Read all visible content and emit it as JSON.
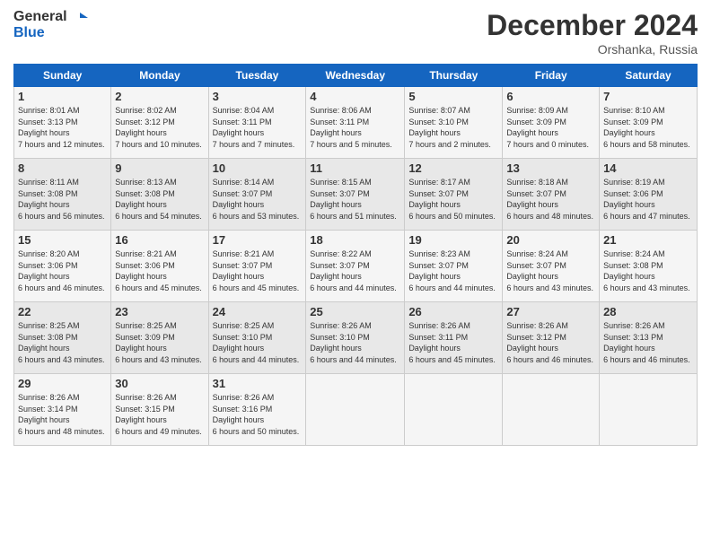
{
  "header": {
    "logo_line1": "General",
    "logo_line2": "Blue",
    "month": "December 2024",
    "location": "Orshanka, Russia"
  },
  "weekdays": [
    "Sunday",
    "Monday",
    "Tuesday",
    "Wednesday",
    "Thursday",
    "Friday",
    "Saturday"
  ],
  "weeks": [
    [
      {
        "day": "1",
        "sunrise": "8:01 AM",
        "sunset": "3:13 PM",
        "daylight": "7 hours and 12 minutes."
      },
      {
        "day": "2",
        "sunrise": "8:02 AM",
        "sunset": "3:12 PM",
        "daylight": "7 hours and 10 minutes."
      },
      {
        "day": "3",
        "sunrise": "8:04 AM",
        "sunset": "3:11 PM",
        "daylight": "7 hours and 7 minutes."
      },
      {
        "day": "4",
        "sunrise": "8:06 AM",
        "sunset": "3:11 PM",
        "daylight": "7 hours and 5 minutes."
      },
      {
        "day": "5",
        "sunrise": "8:07 AM",
        "sunset": "3:10 PM",
        "daylight": "7 hours and 2 minutes."
      },
      {
        "day": "6",
        "sunrise": "8:09 AM",
        "sunset": "3:09 PM",
        "daylight": "7 hours and 0 minutes."
      },
      {
        "day": "7",
        "sunrise": "8:10 AM",
        "sunset": "3:09 PM",
        "daylight": "6 hours and 58 minutes."
      }
    ],
    [
      {
        "day": "8",
        "sunrise": "8:11 AM",
        "sunset": "3:08 PM",
        "daylight": "6 hours and 56 minutes."
      },
      {
        "day": "9",
        "sunrise": "8:13 AM",
        "sunset": "3:08 PM",
        "daylight": "6 hours and 54 minutes."
      },
      {
        "day": "10",
        "sunrise": "8:14 AM",
        "sunset": "3:07 PM",
        "daylight": "6 hours and 53 minutes."
      },
      {
        "day": "11",
        "sunrise": "8:15 AM",
        "sunset": "3:07 PM",
        "daylight": "6 hours and 51 minutes."
      },
      {
        "day": "12",
        "sunrise": "8:17 AM",
        "sunset": "3:07 PM",
        "daylight": "6 hours and 50 minutes."
      },
      {
        "day": "13",
        "sunrise": "8:18 AM",
        "sunset": "3:07 PM",
        "daylight": "6 hours and 48 minutes."
      },
      {
        "day": "14",
        "sunrise": "8:19 AM",
        "sunset": "3:06 PM",
        "daylight": "6 hours and 47 minutes."
      }
    ],
    [
      {
        "day": "15",
        "sunrise": "8:20 AM",
        "sunset": "3:06 PM",
        "daylight": "6 hours and 46 minutes."
      },
      {
        "day": "16",
        "sunrise": "8:21 AM",
        "sunset": "3:06 PM",
        "daylight": "6 hours and 45 minutes."
      },
      {
        "day": "17",
        "sunrise": "8:21 AM",
        "sunset": "3:07 PM",
        "daylight": "6 hours and 45 minutes."
      },
      {
        "day": "18",
        "sunrise": "8:22 AM",
        "sunset": "3:07 PM",
        "daylight": "6 hours and 44 minutes."
      },
      {
        "day": "19",
        "sunrise": "8:23 AM",
        "sunset": "3:07 PM",
        "daylight": "6 hours and 44 minutes."
      },
      {
        "day": "20",
        "sunrise": "8:24 AM",
        "sunset": "3:07 PM",
        "daylight": "6 hours and 43 minutes."
      },
      {
        "day": "21",
        "sunrise": "8:24 AM",
        "sunset": "3:08 PM",
        "daylight": "6 hours and 43 minutes."
      }
    ],
    [
      {
        "day": "22",
        "sunrise": "8:25 AM",
        "sunset": "3:08 PM",
        "daylight": "6 hours and 43 minutes."
      },
      {
        "day": "23",
        "sunrise": "8:25 AM",
        "sunset": "3:09 PM",
        "daylight": "6 hours and 43 minutes."
      },
      {
        "day": "24",
        "sunrise": "8:25 AM",
        "sunset": "3:10 PM",
        "daylight": "6 hours and 44 minutes."
      },
      {
        "day": "25",
        "sunrise": "8:26 AM",
        "sunset": "3:10 PM",
        "daylight": "6 hours and 44 minutes."
      },
      {
        "day": "26",
        "sunrise": "8:26 AM",
        "sunset": "3:11 PM",
        "daylight": "6 hours and 45 minutes."
      },
      {
        "day": "27",
        "sunrise": "8:26 AM",
        "sunset": "3:12 PM",
        "daylight": "6 hours and 46 minutes."
      },
      {
        "day": "28",
        "sunrise": "8:26 AM",
        "sunset": "3:13 PM",
        "daylight": "6 hours and 46 minutes."
      }
    ],
    [
      {
        "day": "29",
        "sunrise": "8:26 AM",
        "sunset": "3:14 PM",
        "daylight": "6 hours and 48 minutes."
      },
      {
        "day": "30",
        "sunrise": "8:26 AM",
        "sunset": "3:15 PM",
        "daylight": "6 hours and 49 minutes."
      },
      {
        "day": "31",
        "sunrise": "8:26 AM",
        "sunset": "3:16 PM",
        "daylight": "6 hours and 50 minutes."
      },
      null,
      null,
      null,
      null
    ]
  ]
}
